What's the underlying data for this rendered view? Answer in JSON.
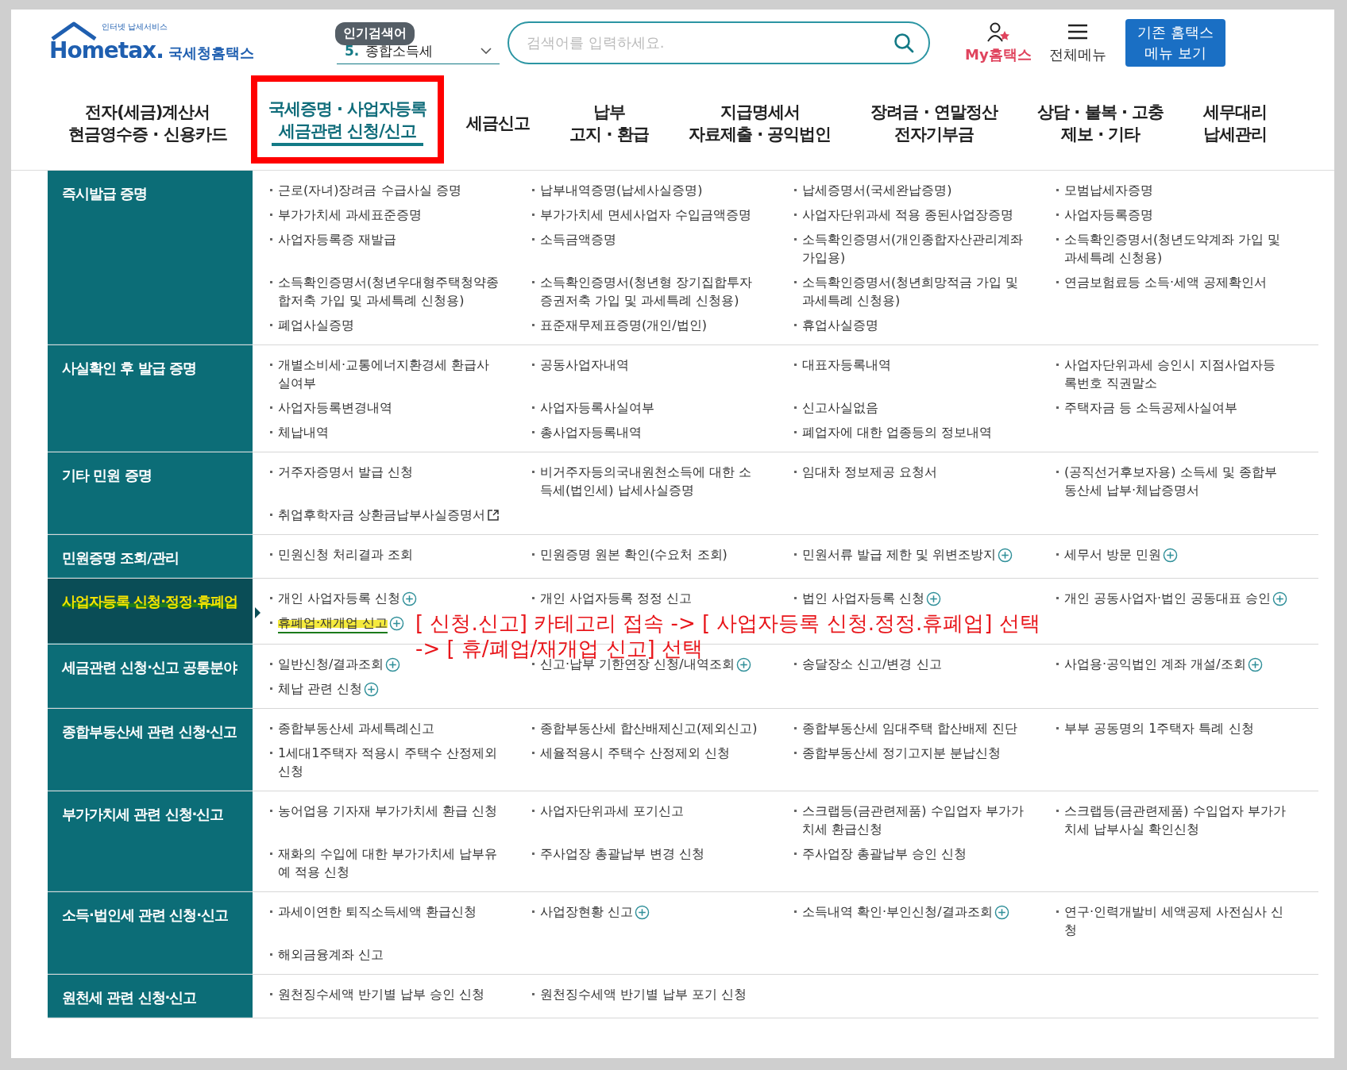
{
  "logo": {
    "tagline": "인터넷 납세서비스",
    "wordmark": "Hometax.",
    "name": "국세청홈택스"
  },
  "popular": {
    "badge": "인기검색어",
    "rank": "5.",
    "keyword": "종합소득세"
  },
  "search": {
    "placeholder": "검색어를 입력하세요."
  },
  "my_link": "My홈택스",
  "all_menu": "전체메뉴",
  "legacy_button": [
    "기존 홈택스",
    "메뉴 보기"
  ],
  "tabs": [
    {
      "lines": [
        "전자(세금)계산서",
        "현금영수증 · 신용카드"
      ],
      "selected": false,
      "boxed": false
    },
    {
      "lines": [
        "국세증명 · 사업자등록",
        "세금관련 신청/신고"
      ],
      "selected": true,
      "boxed": true
    },
    {
      "lines": [
        "세금신고"
      ],
      "selected": false,
      "boxed": false
    },
    {
      "lines": [
        "납부",
        "고지 · 환급"
      ],
      "selected": false,
      "boxed": false
    },
    {
      "lines": [
        "지급명세서",
        "자료제출 · 공익법인"
      ],
      "selected": false,
      "boxed": false
    },
    {
      "lines": [
        "장려금 · 연말정산",
        "전자기부금"
      ],
      "selected": false,
      "boxed": false
    },
    {
      "lines": [
        "상담 · 불복 · 고충",
        "제보 · 기타"
      ],
      "selected": false,
      "boxed": false
    },
    {
      "lines": [
        "세무대리",
        "납세관리"
      ],
      "selected": false,
      "boxed": false
    }
  ],
  "sections": [
    {
      "title": "즉시발급 증명",
      "selected": false,
      "items": [
        {
          "text": "근로(자녀)장려금 수급사실 증명",
          "kind": "plain"
        },
        {
          "text": "납부내역증명(납세사실증명)",
          "kind": "plain"
        },
        {
          "text": "납세증명서(국세완납증명)",
          "kind": "plain"
        },
        {
          "text": "모범납세자증명",
          "kind": "plain"
        },
        {
          "text": "부가가치세 과세표준증명",
          "kind": "plain"
        },
        {
          "text": "부가가치세 면세사업자 수입금액증명",
          "kind": "plain"
        },
        {
          "text": "사업자단위과세 적용 종된사업장증명",
          "kind": "plain"
        },
        {
          "text": "사업자등록증명",
          "kind": "plain"
        },
        {
          "text": "사업자등록증 재발급",
          "kind": "plain"
        },
        {
          "text": "소득금액증명",
          "kind": "plain"
        },
        {
          "text": "소득확인증명서(개인종합자산관리계좌 가입용)",
          "kind": "plain"
        },
        {
          "text": "소득확인증명서(청년도약계좌 가입 및 과세특례 신청용)",
          "kind": "plain"
        },
        {
          "text": "소득확인증명서(청년우대형주택청약종합저축 가입 및 과세특례 신청용)",
          "kind": "plain"
        },
        {
          "text": "소득확인증명서(청년형 장기집합투자증권저축 가입 및 과세특례 신청용)",
          "kind": "plain"
        },
        {
          "text": "소득확인증명서(청년희망적금 가입 및 과세특례 신청용)",
          "kind": "plain"
        },
        {
          "text": "연금보험료등 소득·세액 공제확인서",
          "kind": "plain"
        },
        {
          "text": "폐업사실증명",
          "kind": "plain"
        },
        {
          "text": "표준재무제표증명(개인/법인)",
          "kind": "plain"
        },
        {
          "text": "휴업사실증명",
          "kind": "plain"
        }
      ]
    },
    {
      "title": "사실확인 후 발급 증명",
      "selected": false,
      "items": [
        {
          "text": "개별소비세·교통에너지환경세 환급사실여부",
          "kind": "plain"
        },
        {
          "text": "공동사업자내역",
          "kind": "plain"
        },
        {
          "text": "대표자등록내역",
          "kind": "plain"
        },
        {
          "text": "사업자단위과세 승인시 지점사업자등록번호 직권말소",
          "kind": "plain"
        },
        {
          "text": "사업자등록변경내역",
          "kind": "plain"
        },
        {
          "text": "사업자등록사실여부",
          "kind": "plain"
        },
        {
          "text": "신고사실없음",
          "kind": "plain"
        },
        {
          "text": "주택자금 등 소득공제사실여부",
          "kind": "plain"
        },
        {
          "text": "체납내역",
          "kind": "plain"
        },
        {
          "text": "총사업자등록내역",
          "kind": "plain"
        },
        {
          "text": "폐업자에 대한 업종등의 정보내역",
          "kind": "plain"
        }
      ]
    },
    {
      "title": "기타 민원 증명",
      "selected": false,
      "items": [
        {
          "text": "거주자증명서 발급 신청",
          "kind": "plain"
        },
        {
          "text": "비거주자등의국내원천소득에 대한 소득세(법인세) 납세사실증명",
          "kind": "plain"
        },
        {
          "text": "임대차 정보제공 요청서",
          "kind": "plain"
        },
        {
          "text": "(공직선거후보자용) 소득세 및 종합부동산세 납부·체납증명서",
          "kind": "plain"
        },
        {
          "text": "취업후학자금 상환금납부사실증명서",
          "kind": "external"
        }
      ]
    },
    {
      "title": "민원증명 조회/관리",
      "selected": false,
      "items": [
        {
          "text": "민원신청 처리결과 조회",
          "kind": "plain"
        },
        {
          "text": "민원증명 원본 확인(수요처 조회)",
          "kind": "plain"
        },
        {
          "text": "민원서류 발급 제한 및 위변조방지",
          "kind": "expandable"
        },
        {
          "text": "세무서 방문 민원",
          "kind": "expandable"
        }
      ]
    },
    {
      "title": "사업자등록 신청·정정·휴폐업",
      "selected": true,
      "items": [
        {
          "text": "개인 사업자등록 신청",
          "kind": "expandable"
        },
        {
          "text": "개인 사업자등록 정정 신고",
          "kind": "plain"
        },
        {
          "text": "법인 사업자등록 신청",
          "kind": "expandable"
        },
        {
          "text": "개인 공동사업자·법인 공동대표 승인",
          "kind": "expandable"
        },
        {
          "text": "휴폐업·재개업 신고",
          "kind": "expandable",
          "highlighted": true
        }
      ]
    },
    {
      "title": "세금관련 신청·신고 공통분야",
      "selected": false,
      "items": [
        {
          "text": "일반신청/결과조회",
          "kind": "expandable"
        },
        {
          "text": "신고·납부 기한연장 신청/내역조회",
          "kind": "expandable"
        },
        {
          "text": "송달장소 신고/변경 신고",
          "kind": "plain"
        },
        {
          "text": "사업용·공익법인 계좌 개설/조회",
          "kind": "expandable"
        },
        {
          "text": "체납 관련 신청",
          "kind": "expandable"
        }
      ]
    },
    {
      "title": "종합부동산세 관련 신청·신고",
      "selected": false,
      "items": [
        {
          "text": "종합부동산세 과세특례신고",
          "kind": "plain"
        },
        {
          "text": "종합부동산세 합산배제신고(제외신고)",
          "kind": "plain"
        },
        {
          "text": "종합부동산세 임대주택 합산배제 진단",
          "kind": "plain"
        },
        {
          "text": "부부 공동명의 1주택자 특례 신청",
          "kind": "plain"
        },
        {
          "text": "1세대1주택자 적용시 주택수 산정제외 신청",
          "kind": "plain"
        },
        {
          "text": "세율적용시 주택수 산정제외 신청",
          "kind": "plain"
        },
        {
          "text": "종합부동산세 정기고지분 분납신청",
          "kind": "plain"
        }
      ]
    },
    {
      "title": "부가가치세 관련 신청·신고",
      "selected": false,
      "items": [
        {
          "text": "농어업용 기자재 부가가치세 환급 신청",
          "kind": "plain"
        },
        {
          "text": "사업자단위과세 포기신고",
          "kind": "plain"
        },
        {
          "text": "스크랩등(금관련제품) 수입업자 부가가치세 환급신청",
          "kind": "plain"
        },
        {
          "text": "스크랩등(금관련제품) 수입업자 부가가치세 납부사실 확인신청",
          "kind": "plain"
        },
        {
          "text": "재화의 수입에 대한 부가가치세 납부유예 적용 신청",
          "kind": "plain"
        },
        {
          "text": "주사업장 총괄납부 변경 신청",
          "kind": "plain"
        },
        {
          "text": "주사업장 총괄납부 승인 신청",
          "kind": "plain"
        }
      ]
    },
    {
      "title": "소득·법인세 관련 신청·신고",
      "selected": false,
      "items": [
        {
          "text": "과세이연한 퇴직소득세액 환급신청",
          "kind": "plain"
        },
        {
          "text": "사업장현황 신고",
          "kind": "expandable"
        },
        {
          "text": "소득내역 확인·부인신청/결과조회",
          "kind": "expandable"
        },
        {
          "text": "연구·인력개발비 세액공제 사전심사 신청",
          "kind": "plain"
        },
        {
          "text": "해외금융계좌 신고",
          "kind": "plain"
        }
      ]
    },
    {
      "title": "원천세 관련 신청·신고",
      "selected": false,
      "items": [
        {
          "text": "원천징수세액 반기별 납부 승인 신청",
          "kind": "plain"
        },
        {
          "text": "원천징수세액 반기별 납부 포기 신청",
          "kind": "plain"
        }
      ]
    }
  ],
  "annotation": [
    "[ 신청.신고] 카테고리 접속 -> [ 사업자등록 신청.정정.휴폐업] 선택",
    "-> [ 휴/폐업/재개업 신고] 선택"
  ]
}
